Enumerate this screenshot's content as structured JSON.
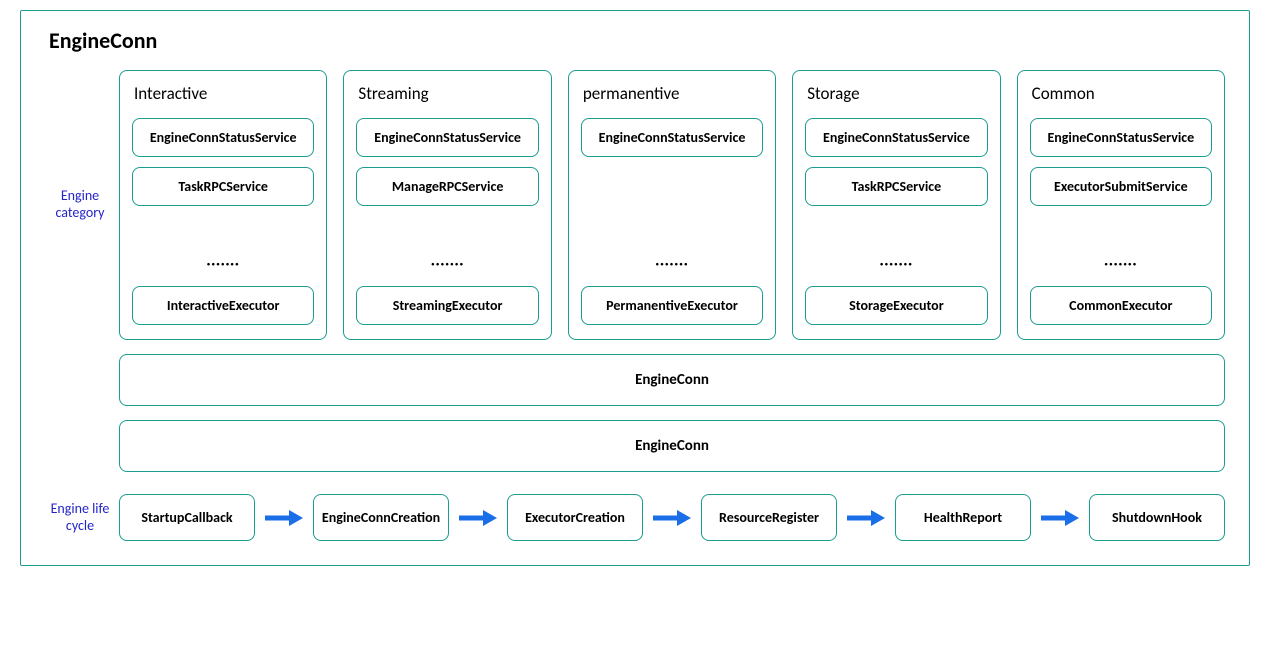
{
  "title": "EngineConn",
  "labels": {
    "engine_category": "Engine category",
    "engine_life_cycle": "Engine life cycle"
  },
  "ellipsis": "·······",
  "categories": [
    {
      "title": "Interactive",
      "services": [
        "EngineConnStatusService",
        "TaskRPCService"
      ],
      "executor": "InteractiveExecutor"
    },
    {
      "title": "Streaming",
      "services": [
        "EngineConnStatusService",
        "ManageRPCService"
      ],
      "executor": "StreamingExecutor"
    },
    {
      "title": "permanentive",
      "services": [
        "EngineConnStatusService"
      ],
      "executor": "PermanentiveExecutor"
    },
    {
      "title": "Storage",
      "services": [
        "EngineConnStatusService",
        "TaskRPCService"
      ],
      "executor": "StorageExecutor"
    },
    {
      "title": "Common",
      "services": [
        "EngineConnStatusService",
        "ExecutorSubmitService"
      ],
      "executor": "CommonExecutor"
    }
  ],
  "wide_boxes": [
    "EngineConn",
    "EngineConn"
  ],
  "lifecycle": [
    "StartupCallback",
    "EngineConnCreation",
    "ExecutorCreation",
    "ResourceRegister",
    "HealthReport",
    "ShutdownHook"
  ],
  "colors": {
    "border": "#1b9e8f",
    "arrow": "#1a6fe8",
    "side_label": "#2323c9"
  }
}
